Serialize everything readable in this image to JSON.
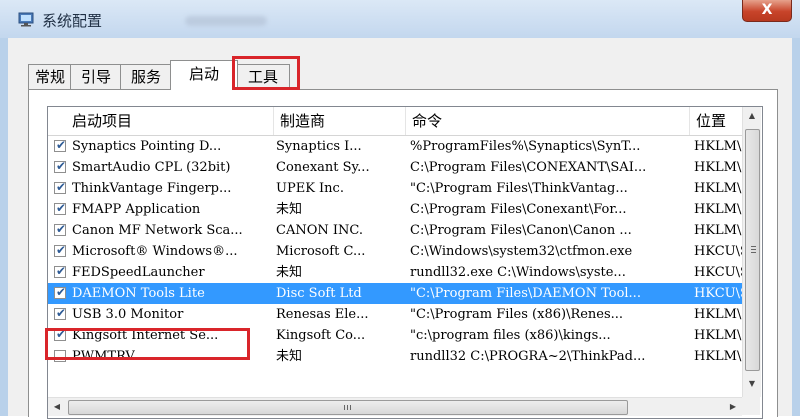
{
  "window": {
    "title": "系统配置",
    "close_label": "X"
  },
  "tabs": [
    {
      "label": "常规"
    },
    {
      "label": "引导"
    },
    {
      "label": "服务"
    },
    {
      "label": "启动",
      "active": true
    },
    {
      "label": "工具"
    }
  ],
  "columns": {
    "item": "启动项目",
    "maker": "制造商",
    "command": "命令",
    "location": "位置"
  },
  "rows": [
    {
      "checked": true,
      "item": "Synaptics Pointing D...",
      "maker": "Synaptics I...",
      "command": "%ProgramFiles%\\Synaptics\\SynT...",
      "location": "HKLM\\SC"
    },
    {
      "checked": true,
      "item": "SmartAudio CPL (32bit)",
      "maker": "Conexant Sy...",
      "command": "C:\\Program Files\\CONEXANT\\SAI...",
      "location": "HKLM\\SC"
    },
    {
      "checked": true,
      "item": "ThinkVantage Fingerp...",
      "maker": "UPEK Inc.",
      "command": "\"C:\\Program Files\\ThinkVantag...",
      "location": "HKLM\\SC"
    },
    {
      "checked": true,
      "item": "FMAPP Application",
      "maker": "未知",
      "command": "C:\\Program Files\\Conexant\\For...",
      "location": "HKLM\\SC"
    },
    {
      "checked": true,
      "item": "Canon MF Network Sca...",
      "maker": "CANON INC.",
      "command": "C:\\Program Files\\Canon\\Canon ...",
      "location": "HKLM\\SC"
    },
    {
      "checked": true,
      "item": "Microsoft® Windows®...",
      "maker": "Microsoft C...",
      "command": "C:\\Windows\\system32\\ctfmon.exe",
      "location": "HKCU\\SC"
    },
    {
      "checked": true,
      "item": "FEDSpeedLauncher",
      "maker": "未知",
      "command": "rundll32.exe C:\\Windows\\syste...",
      "location": "HKCU\\SC"
    },
    {
      "checked": true,
      "item": "DAEMON Tools Lite",
      "maker": "Disc Soft Ltd",
      "command": "\"C:\\Program Files\\DAEMON Tool...",
      "location": "HKCU\\SC",
      "selected": true
    },
    {
      "checked": true,
      "item": "USB 3.0 Monitor",
      "maker": "Renesas Ele...",
      "command": "\"C:\\Program Files (x86)\\Renes...",
      "location": "HKLM\\SC"
    },
    {
      "checked": true,
      "item": "Kingsoft Internet Se...",
      "maker": "Kingsoft Co...",
      "command": "\"c:\\program files (x86)\\kings...",
      "location": "HKLM\\SC"
    },
    {
      "checked": false,
      "item": "PWMTRV",
      "maker": "未知",
      "command": "rundll32 C:\\PROGRA~2\\ThinkPad...",
      "location": "HKLM\\SC"
    }
  ],
  "colors": {
    "selection": "#3399ff",
    "highlight_box": "#d9252a"
  }
}
